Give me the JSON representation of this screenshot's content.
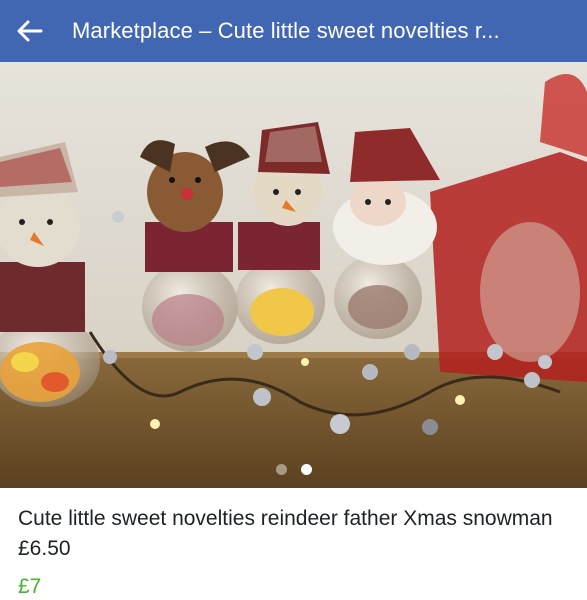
{
  "header": {
    "title": "Marketplace – Cute little sweet novelties r...",
    "background": "#4267b2",
    "back_icon": "arrow-left-icon"
  },
  "photo": {
    "description_icon": "listing-photo",
    "carousel": {
      "total": 2,
      "active_index": 1
    }
  },
  "listing": {
    "title": "Cute little sweet novelties reindeer father Xmas snowman £6.50",
    "price": "£7",
    "price_color": "#42b72a"
  }
}
